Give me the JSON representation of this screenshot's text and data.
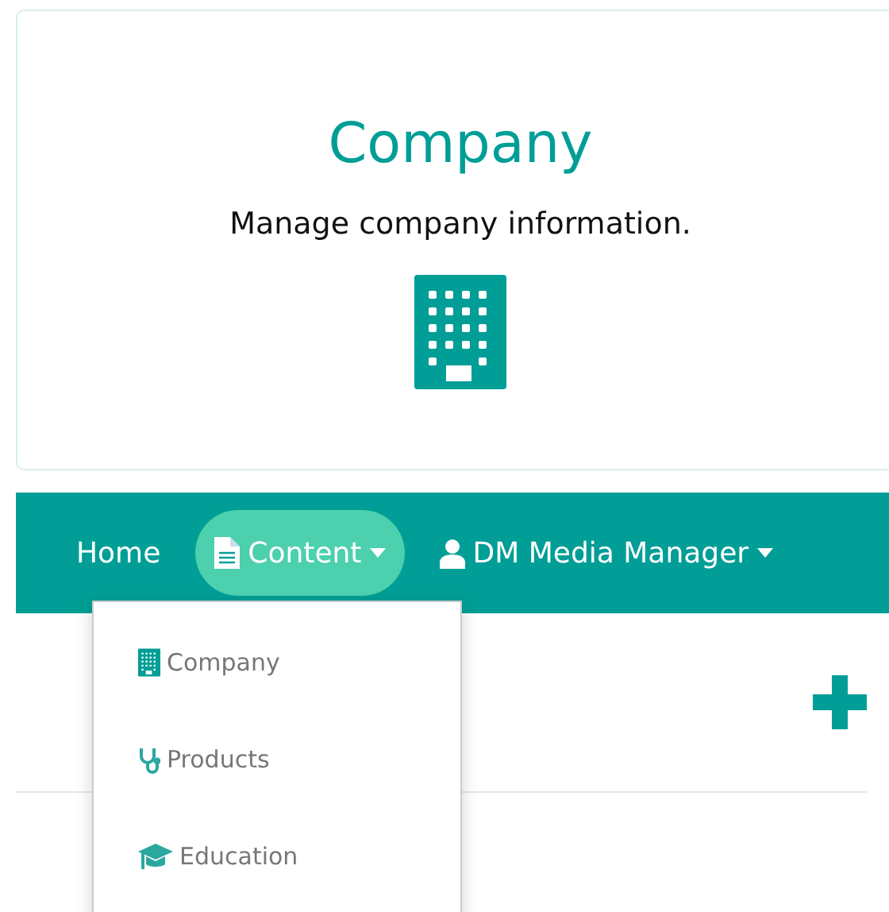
{
  "card": {
    "title": "Company",
    "description": "Manage company information."
  },
  "navbar": {
    "items": [
      {
        "label": "Home",
        "selected": false,
        "dropdown": false
      },
      {
        "label": "Content",
        "selected": true,
        "dropdown": true,
        "menu": {
          "open": true,
          "items": [
            {
              "label": "Company"
            },
            {
              "label": "Products"
            },
            {
              "label": "Education"
            }
          ]
        }
      },
      {
        "label": "DM Media Manager",
        "selected": false,
        "dropdown": true
      }
    ]
  }
}
